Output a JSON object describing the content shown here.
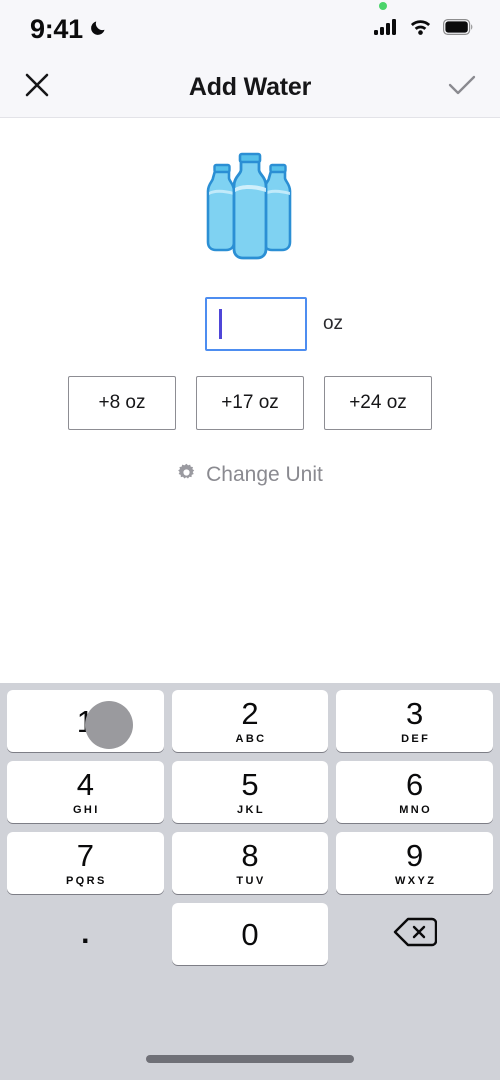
{
  "status_bar": {
    "time": "9:41",
    "dnd_icon": "moon-icon",
    "signal_icon": "cellular-signal-icon",
    "wifi_icon": "wifi-icon",
    "battery_icon": "battery-full-icon",
    "recording_dot": "green-status-dot"
  },
  "header": {
    "close_icon": "close-x-icon",
    "title": "Add Water",
    "confirm_icon": "checkmark-icon",
    "confirm_color": "#8a8a90"
  },
  "illustration": {
    "name": "water-bottles-icon",
    "fill_color": "#7fd2f2",
    "outline_color": "#2b8fd4",
    "cap_color": "#56c0ea",
    "bottle_count": 3
  },
  "amount": {
    "value": "",
    "placeholder": "",
    "unit": "oz",
    "caret_color": "#4f46d8",
    "border_color": "#4d8df0"
  },
  "quick_add": [
    {
      "label": "+8 oz"
    },
    {
      "label": "+17 oz"
    },
    {
      "label": "+24 oz"
    }
  ],
  "change_unit": {
    "icon": "gear-icon",
    "label": "Change Unit",
    "color": "#8a8a90"
  },
  "keyboard": {
    "background": "#d0d2d8",
    "rows": [
      [
        {
          "digit": "1",
          "letters": "",
          "type": "key",
          "pressed": true
        },
        {
          "digit": "2",
          "letters": "ABC",
          "type": "key",
          "pressed": false
        },
        {
          "digit": "3",
          "letters": "DEF",
          "type": "key",
          "pressed": false
        }
      ],
      [
        {
          "digit": "4",
          "letters": "GHI",
          "type": "key",
          "pressed": false
        },
        {
          "digit": "5",
          "letters": "JKL",
          "type": "key",
          "pressed": false
        },
        {
          "digit": "6",
          "letters": "MNO",
          "type": "key",
          "pressed": false
        }
      ],
      [
        {
          "digit": "7",
          "letters": "PQRS",
          "type": "key",
          "pressed": false
        },
        {
          "digit": "8",
          "letters": "TUV",
          "type": "key",
          "pressed": false
        },
        {
          "digit": "9",
          "letters": "WXYZ",
          "type": "key",
          "pressed": false
        }
      ],
      [
        {
          "digit": ".",
          "letters": "",
          "type": "decimal",
          "pressed": false
        },
        {
          "digit": "0",
          "letters": "",
          "type": "key",
          "pressed": false
        },
        {
          "digit": "",
          "letters": "",
          "type": "delete",
          "pressed": false
        }
      ]
    ],
    "delete_icon": "backspace-delete-icon",
    "touch_indicator": "touch-press-indicator"
  },
  "home_indicator": {
    "name": "home-indicator-bar"
  }
}
